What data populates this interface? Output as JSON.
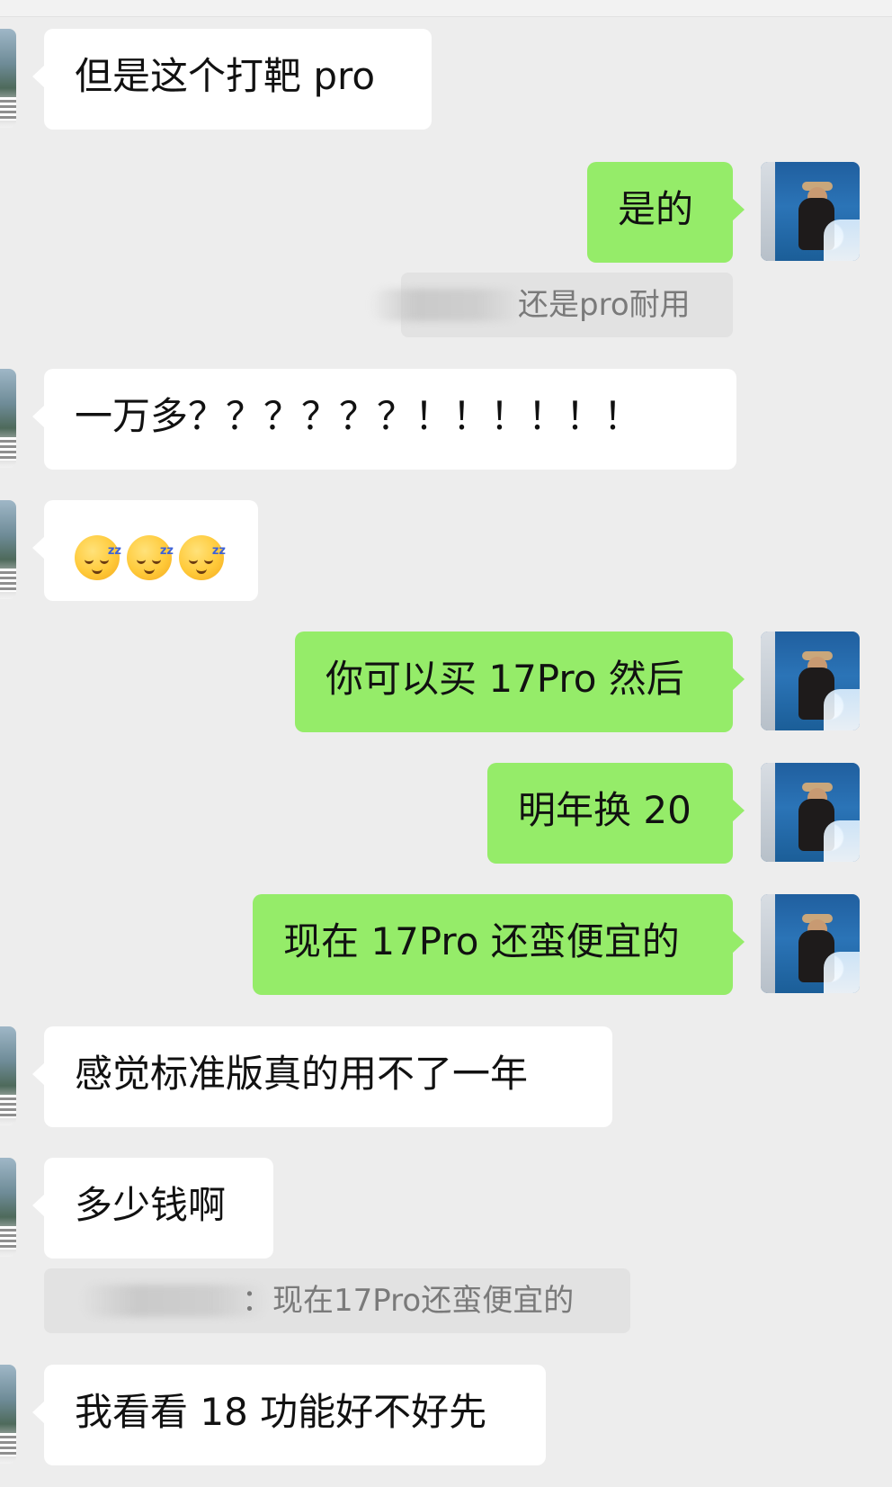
{
  "messages": [
    {
      "text": "但是这个打靶 pro"
    },
    {
      "text": "是的"
    },
    {
      "quote": "还是pro耐用"
    },
    {
      "text": "一万多？？？？？？！！！！！！"
    },
    {
      "emoji_name": "sleeping-face-emoji",
      "emoji_count": 3
    },
    {
      "text": "你可以买 17Pro 然后"
    },
    {
      "text": "明年换 20"
    },
    {
      "text": "现在 17Pro 还蛮便宜的"
    },
    {
      "text": "感觉标准版真的用不了一年"
    },
    {
      "text": "多少钱啊"
    },
    {
      "quote": "：现在17Pro还蛮便宜的"
    },
    {
      "text": "我看看 18 功能好不好先"
    }
  ],
  "emoji_z": "zz"
}
